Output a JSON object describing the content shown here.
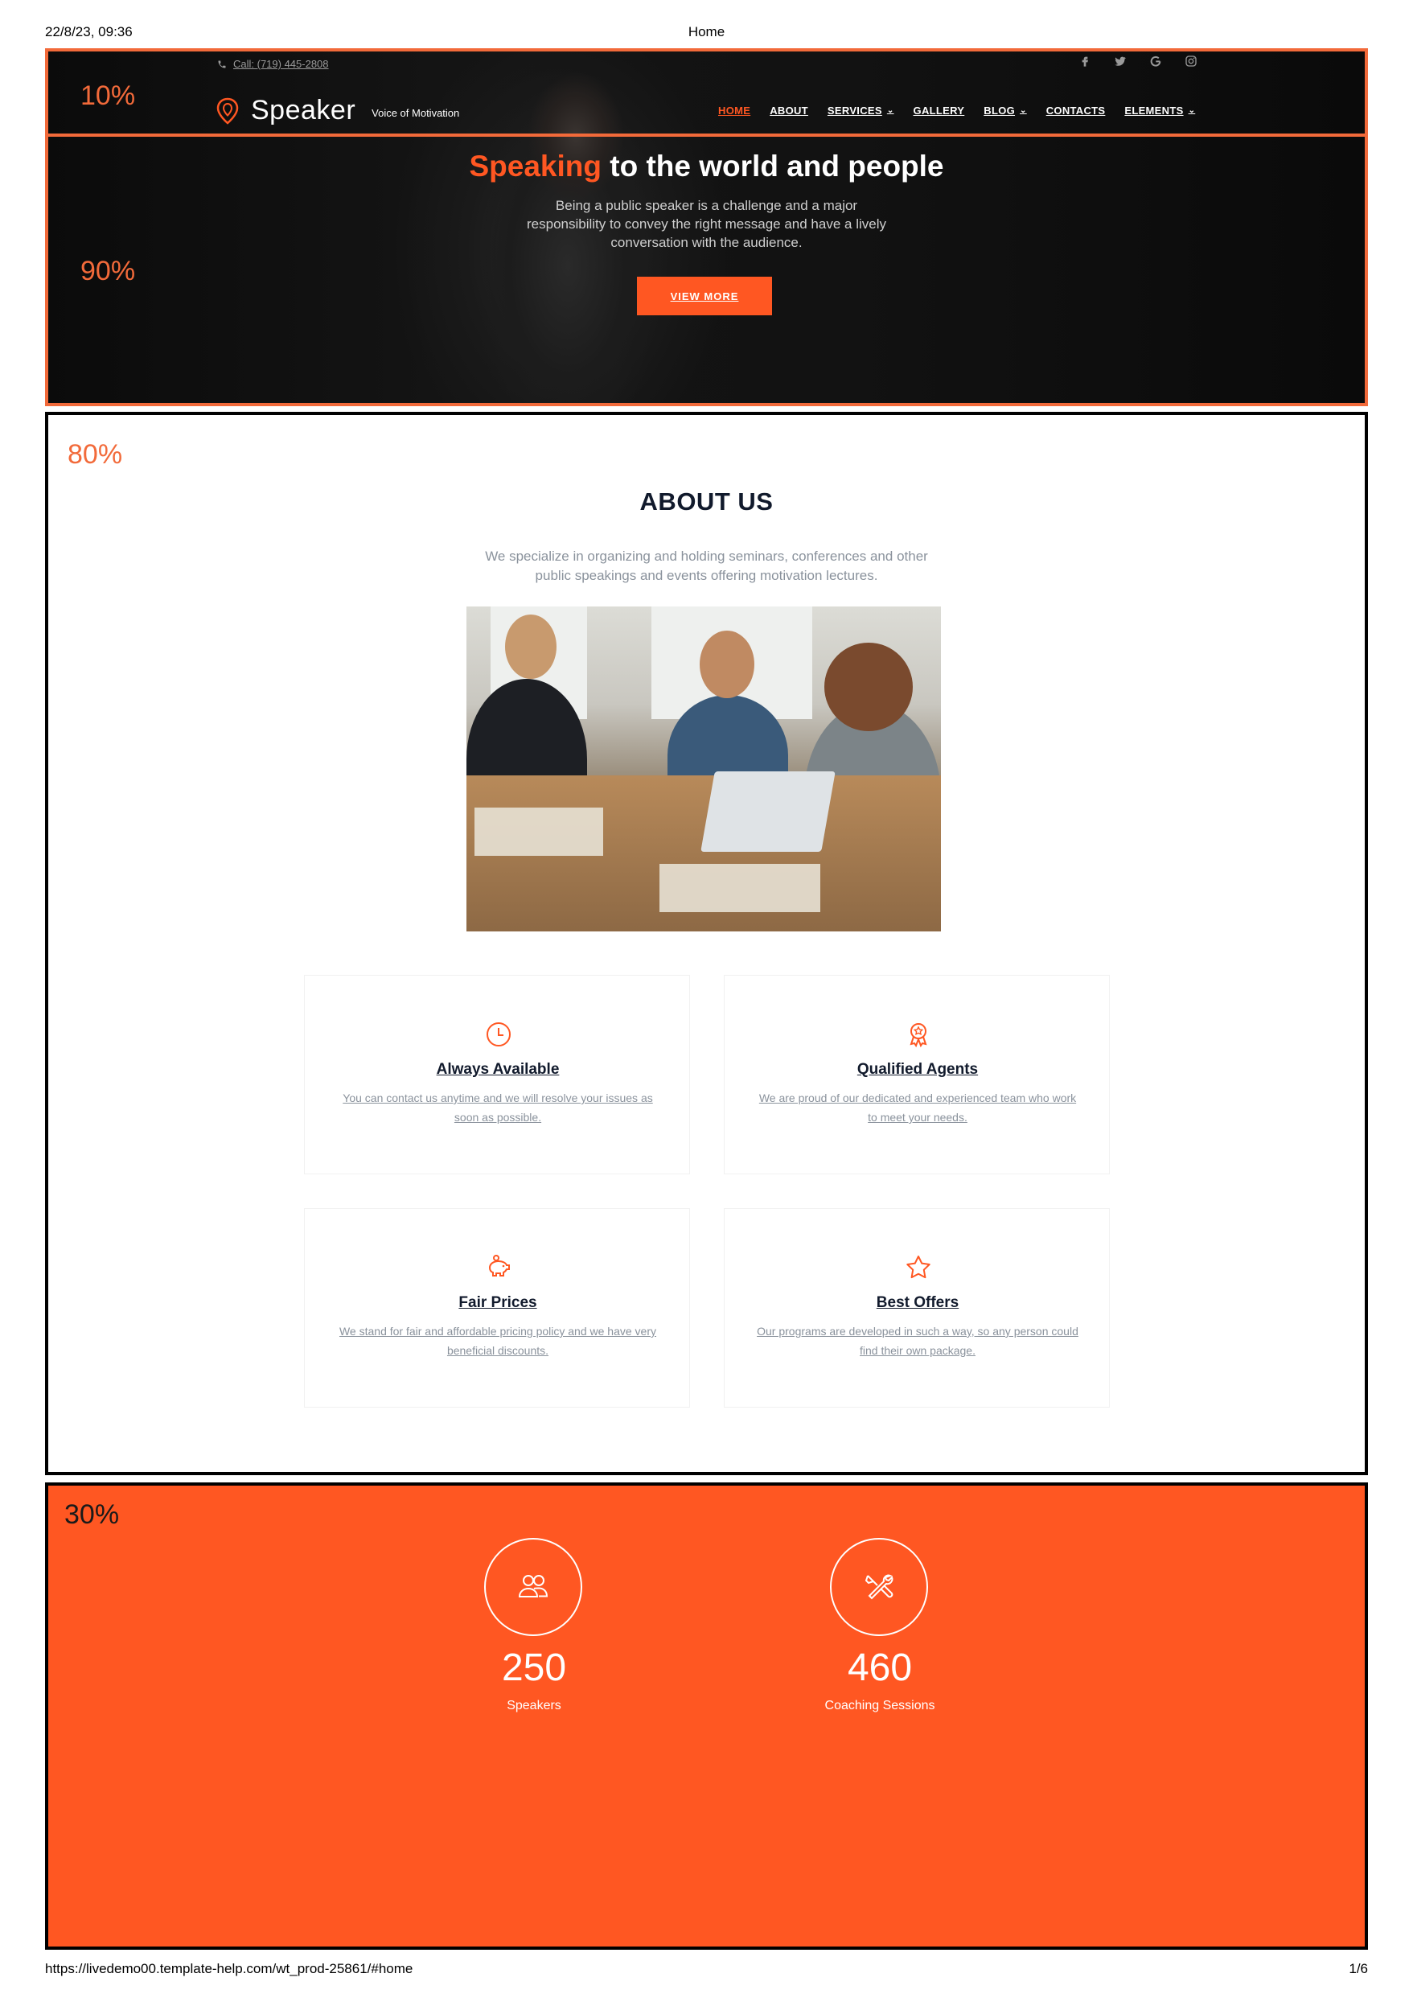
{
  "print": {
    "date": "22/8/23, 09:36",
    "title": "Home",
    "url": "https://livedemo00.template-help.com/wt_prod-25861/#home",
    "page": "1/6"
  },
  "annotations": {
    "top_bar": "10%",
    "hero": "90%",
    "about": "80%",
    "stats": "30%"
  },
  "topbar": {
    "phone": "Call: (719) 445-2808",
    "socials": [
      "facebook-icon",
      "twitter-icon",
      "google-icon",
      "instagram-icon"
    ]
  },
  "brand": {
    "name": "Speaker",
    "tagline": "Voice of Motivation",
    "accent": "#ff5722"
  },
  "nav": {
    "items": [
      {
        "label": "HOME",
        "active": true
      },
      {
        "label": "ABOUT"
      },
      {
        "label": "SERVICES",
        "dropdown": true
      },
      {
        "label": "GALLERY"
      },
      {
        "label": "BLOG",
        "dropdown": true
      },
      {
        "label": "CONTACTS"
      },
      {
        "label": "ELEMENTS",
        "dropdown": true
      }
    ]
  },
  "hero": {
    "title_accent": "Speaking",
    "title_rest": " to the world and people",
    "text": "Being a public speaker is a challenge and a major responsibility to convey the right message and have a lively conversation with the audience.",
    "button": "VIEW MORE"
  },
  "about": {
    "title": "ABOUT US",
    "text": "We specialize in organizing and holding seminars, conferences and other public speakings and events offering motivation lectures.",
    "features": [
      {
        "icon": "clock-icon",
        "title": "Always Available",
        "text": "You can contact us anytime and we will resolve your issues as soon as possible."
      },
      {
        "icon": "award-icon",
        "title": "Qualified Agents",
        "text": "We are proud of our dedicated and experienced team who work to meet your needs."
      },
      {
        "icon": "piggy-bank-icon",
        "title": "Fair Prices",
        "text": "We stand for fair and affordable pricing policy and we have very beneficial discounts."
      },
      {
        "icon": "star-icon",
        "title": "Best Offers",
        "text": "Our programs are developed in such a way, so any person could find their own package."
      }
    ]
  },
  "stats": [
    {
      "icon": "users-icon",
      "value": "250",
      "label": "Speakers"
    },
    {
      "icon": "tools-icon",
      "value": "460",
      "label": "Coaching Sessions"
    }
  ]
}
